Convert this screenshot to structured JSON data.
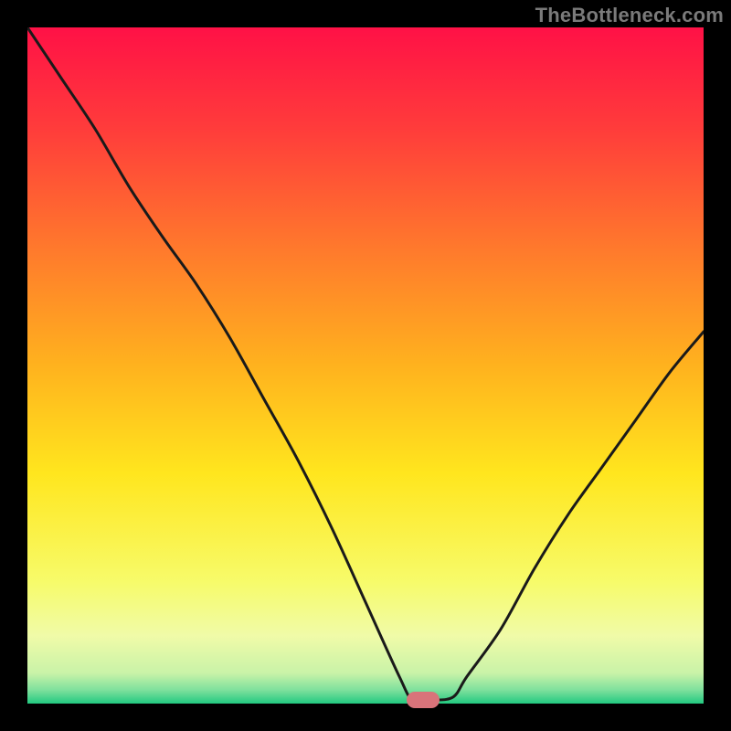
{
  "watermark": "TheBottleneck.com",
  "colors": {
    "frame_bg": "#000000",
    "watermark_text": "#7a7a7a",
    "curve_stroke": "#1a1a1a",
    "marker_fill": "#d9737a",
    "gradient_stops": [
      {
        "offset": 0.0,
        "color": "#ff1146"
      },
      {
        "offset": 0.15,
        "color": "#ff3c3b"
      },
      {
        "offset": 0.33,
        "color": "#ff7a2c"
      },
      {
        "offset": 0.5,
        "color": "#ffb21e"
      },
      {
        "offset": 0.66,
        "color": "#ffe61e"
      },
      {
        "offset": 0.82,
        "color": "#f7fb6a"
      },
      {
        "offset": 0.9,
        "color": "#f0fba8"
      },
      {
        "offset": 0.955,
        "color": "#c9f3a8"
      },
      {
        "offset": 0.98,
        "color": "#7ee09d"
      },
      {
        "offset": 1.0,
        "color": "#22c980"
      }
    ]
  },
  "chart_data": {
    "type": "line",
    "title": "",
    "xlabel": "",
    "ylabel": "",
    "xlim": [
      0,
      100
    ],
    "ylim": [
      0,
      100
    ],
    "x": [
      0,
      5,
      10,
      15,
      20,
      25,
      30,
      35,
      40,
      45,
      50,
      55,
      57,
      60,
      63,
      65,
      70,
      75,
      80,
      85,
      90,
      95,
      100
    ],
    "values": [
      100,
      92.5,
      85,
      76.5,
      69,
      62,
      54,
      45,
      36,
      26,
      15,
      4,
      0.5,
      0.5,
      1,
      4,
      11,
      20,
      28,
      35,
      42,
      49,
      55
    ],
    "marker": {
      "x": 58.5,
      "y": 0.5
    },
    "notes": "V-shaped bottleneck curve; trough ~58% along x-axis at ~0.5% of y-range. Left branch starts at top-left (100%). Right branch rises to ~55% at x=100."
  }
}
